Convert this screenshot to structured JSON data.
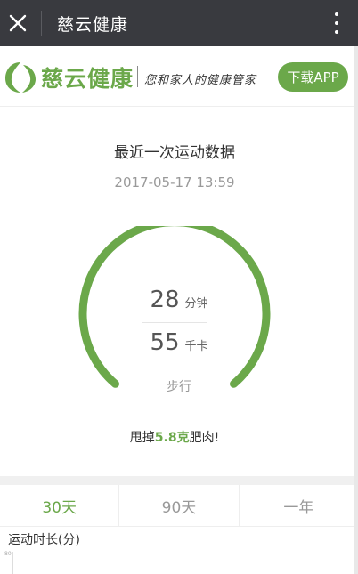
{
  "topbar": {
    "title": "慈云健康",
    "close_icon": "close-icon",
    "more_icon": "more-vertical-icon"
  },
  "brand": {
    "logo_icon": "cross-leaf-logo",
    "name": "慈云健康",
    "slogan": "您和家人的健康管家",
    "download_button": "下载APP",
    "accent_color": "#6ba84a"
  },
  "summary": {
    "heading": "最近一次运动数据",
    "timestamp": "2017-05-17 13:59",
    "duration_value": "28",
    "duration_unit": "分钟",
    "calories_value": "55",
    "calories_unit": "千卡",
    "activity_type": "步行",
    "burn_prefix": "甩掉",
    "burn_amount": "5.8克",
    "burn_suffix": "肥肉!"
  },
  "tabs": [
    {
      "label": "30天",
      "active": true
    },
    {
      "label": "90天",
      "active": false
    },
    {
      "label": "一年",
      "active": false
    }
  ],
  "chart": {
    "label": "运动时长(分)",
    "tick": "80"
  }
}
